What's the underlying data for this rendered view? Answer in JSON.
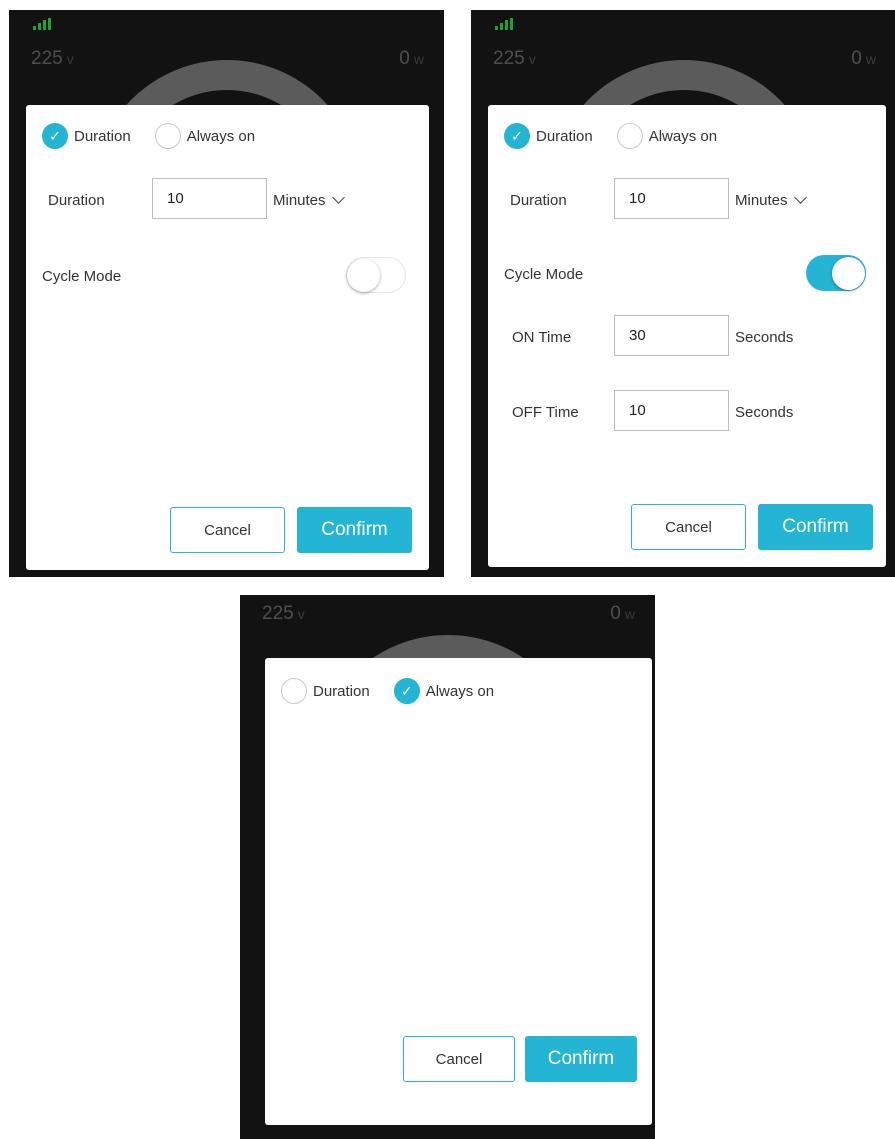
{
  "accent_color": "#23b5d3",
  "signal_color": "#1fa13a",
  "screens": [
    {
      "voltage": {
        "value": "225",
        "unit": "v"
      },
      "power": {
        "value": "0",
        "unit": "w"
      },
      "mode_options": [
        {
          "label": "Duration",
          "checked": true
        },
        {
          "label": "Always on",
          "checked": false
        }
      ],
      "duration": {
        "label": "Duration",
        "value": "10",
        "unit": "Minutes"
      },
      "cycle_mode": {
        "label": "Cycle Mode",
        "enabled": false
      },
      "cancel_label": "Cancel",
      "confirm_label": "Confirm"
    },
    {
      "voltage": {
        "value": "225",
        "unit": "v"
      },
      "power": {
        "value": "0",
        "unit": "w"
      },
      "mode_options": [
        {
          "label": "Duration",
          "checked": true
        },
        {
          "label": "Always on",
          "checked": false
        }
      ],
      "duration": {
        "label": "Duration",
        "value": "10",
        "unit": "Minutes"
      },
      "cycle_mode": {
        "label": "Cycle Mode",
        "enabled": true
      },
      "on_time": {
        "label": "ON Time",
        "value": "30",
        "unit": "Seconds"
      },
      "off_time": {
        "label": "OFF Time",
        "value": "10",
        "unit": "Seconds"
      },
      "cancel_label": "Cancel",
      "confirm_label": "Confirm"
    },
    {
      "voltage": {
        "value": "225",
        "unit": "v"
      },
      "power": {
        "value": "0",
        "unit": "w"
      },
      "mode_options": [
        {
          "label": "Duration",
          "checked": false
        },
        {
          "label": "Always on",
          "checked": true
        }
      ],
      "cancel_label": "Cancel",
      "confirm_label": "Confirm"
    }
  ]
}
